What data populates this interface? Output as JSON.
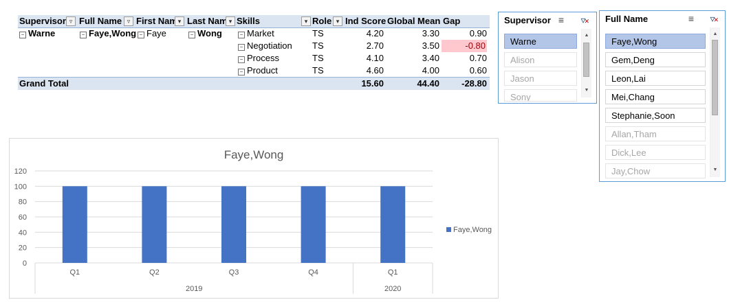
{
  "pivot": {
    "headers": {
      "supervisor": "Supervisor",
      "full_name": "Full Name",
      "first_name": "First Nam",
      "last_name": "Last Nam",
      "skills": "Skills",
      "role": "Role",
      "ind_score": "Ind Score",
      "global_mean": "Global Mean",
      "gap": "Gap"
    },
    "group": {
      "supervisor": "Warne",
      "full_name": "Faye,Wong",
      "first_name": "Faye",
      "last_name": "Wong"
    },
    "rows": [
      {
        "skill": "Market",
        "role": "TS",
        "ind": "4.20",
        "mean": "3.30",
        "gap": "0.90"
      },
      {
        "skill": "Negotiation",
        "role": "TS",
        "ind": "2.70",
        "mean": "3.50",
        "gap": "-0.80"
      },
      {
        "skill": "Process",
        "role": "TS",
        "ind": "4.10",
        "mean": "3.40",
        "gap": "0.70"
      },
      {
        "skill": "Product",
        "role": "TS",
        "ind": "4.60",
        "mean": "4.00",
        "gap": "0.60"
      }
    ],
    "total": {
      "label": "Grand Total",
      "ind": "15.60",
      "mean": "44.40",
      "gap": "-28.80"
    },
    "colors": {
      "header_fill": "#dbe5f1",
      "negative_fill": "#ffc7ce",
      "negative_text": "#9c0006"
    }
  },
  "supervisor_slicer": {
    "title": "Supervisor",
    "items": [
      {
        "label": "Warne",
        "state": "selected"
      },
      {
        "label": "Alison",
        "state": "unavailable"
      },
      {
        "label": "Jason",
        "state": "unavailable"
      },
      {
        "label": "Sony",
        "state": "unavailable"
      }
    ]
  },
  "fullname_slicer": {
    "title": "Full Name",
    "items": [
      {
        "label": "Faye,Wong",
        "state": "selected"
      },
      {
        "label": "Gem,Deng",
        "state": "available"
      },
      {
        "label": "Leon,Lai",
        "state": "available"
      },
      {
        "label": "Mei,Chang",
        "state": "available"
      },
      {
        "label": "Stephanie,Soon",
        "state": "available"
      },
      {
        "label": "Allan,Tham",
        "state": "unavailable"
      },
      {
        "label": "Dick,Lee",
        "state": "unavailable"
      },
      {
        "label": "Jay,Chow",
        "state": "unavailable"
      }
    ]
  },
  "icons": [
    "multi-select-icon",
    "clear-filter-icon",
    "filter-button-icon",
    "dropdown-arrow-icon",
    "collapse-icon",
    "scroll-up-icon",
    "scroll-down-icon"
  ],
  "chart_data": {
    "type": "bar",
    "title": "Faye,Wong",
    "categories": [
      "Q1",
      "Q2",
      "Q3",
      "Q4",
      "Q1"
    ],
    "groups": [
      {
        "label": "2019",
        "span": 4
      },
      {
        "label": "2020",
        "span": 1
      }
    ],
    "series": [
      {
        "name": "Faye,Wong",
        "values": [
          100,
          100,
          100,
          100,
          100
        ]
      }
    ],
    "yticks": [
      "0",
      "20",
      "40",
      "60",
      "80",
      "100",
      "120"
    ],
    "ylim": [
      0,
      120
    ],
    "grid": true,
    "legend": "right",
    "color": "#4472c4"
  }
}
